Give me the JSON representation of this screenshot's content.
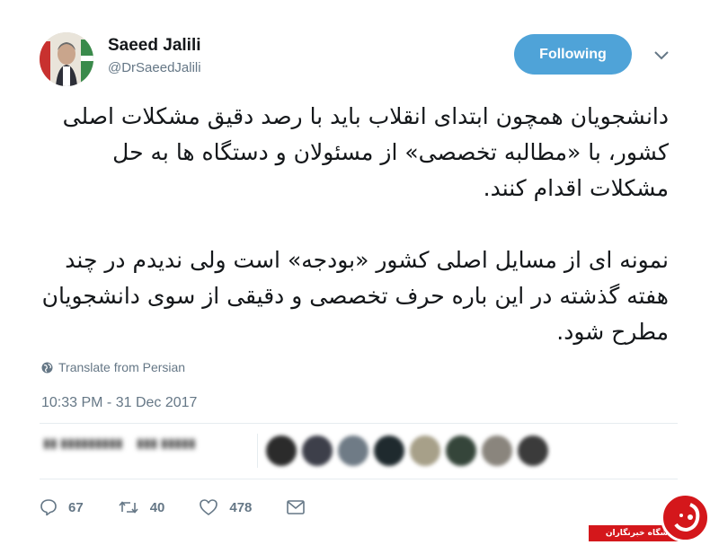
{
  "user": {
    "name": "Saeed Jalili",
    "handle": "@DrSaeedJalili",
    "follow_label": "Following"
  },
  "tweet": {
    "paragraphs": [
      "دانشجویان همچون ابتدای انقلاب باید با رصد دقیق مشکلات اصلی کشور، با «مطالبه تخصصی» از مسئولان و دستگاه ها به حل مشکلات اقدام کنند.",
      "نمونه ای از مسایل اصلی کشور «بودجه» است ولی ندیدم در چند هفته گذشته در این باره حرف تخصصی و دقیقی از سوی دانشجویان مطرح شود."
    ],
    "translate_label": "Translate from Persian",
    "timestamp": "10:33 PM - 31 Dec 2017"
  },
  "actions": {
    "replies": "67",
    "retweets": "40",
    "likes": "478"
  },
  "watermark": {
    "text": "باشگاه خبرنگاران"
  },
  "colors": {
    "follow_button": "#4fa3d8",
    "muted": "#657786",
    "watermark_red": "#d4171b"
  }
}
